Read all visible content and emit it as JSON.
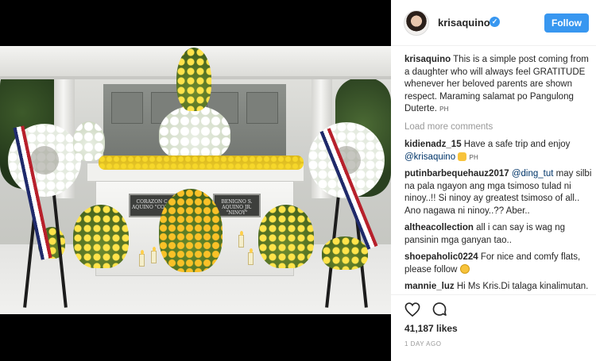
{
  "profile": {
    "username": "krisaquino",
    "follow_label": "Follow"
  },
  "photo": {
    "plaque_left": "CORAZON C. AQUINO \"CORY\"",
    "plaque_right": "BENIGNO S. AQUINO JR. \"NINOY\""
  },
  "comments": {
    "caption": {
      "user": "krisaquino",
      "text": "This is a simple post coming from a daughter who will always feel GRATITUDE whenever her beloved parents are shown respect. Maraming salamat po Pangulong Duterte.",
      "tag": "PH"
    },
    "load_more": "Load more comments",
    "items": [
      {
        "user": "kidienadz_15",
        "text_before": "Have a safe trip and enjoy",
        "mention": "@krisaquino",
        "emoji": "thumbs-up-icon",
        "tag": "PH"
      },
      {
        "user": "putinbarbequehauz2017",
        "mention": "@ding_tut",
        "text": "may silbi na pala ngayon ang mga tsimoso tulad ni ninoy..!! Si ninoy ay greatest tsimoso of all.. Ano nagawa ni ninoy..?? Aber.."
      },
      {
        "user": "altheacollection",
        "text": "all i can say is wag ng pansinin mga ganyan tao.."
      },
      {
        "user": "shoepaholic0224",
        "text": "For nice and comfy flats, please follow",
        "emoji": "smile-icon"
      },
      {
        "user": "mannie_luz",
        "text": "Hi Ms Kris.Di talaga kinalimutan. I PRRD especially your mom"
      }
    ]
  },
  "footer": {
    "likes": "41,187 likes",
    "timestamp": "1 DAY AGO"
  },
  "colors": {
    "accent": "#3897f0",
    "text": "#262626",
    "muted": "#999999",
    "mention": "#003569"
  }
}
